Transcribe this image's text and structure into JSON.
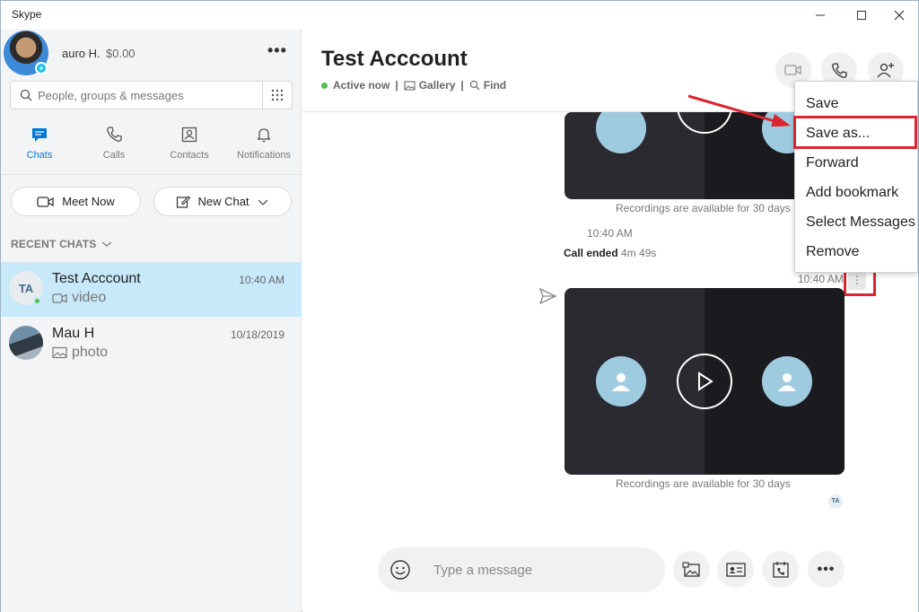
{
  "window": {
    "title": "Skype"
  },
  "profile": {
    "name": "auro H.",
    "credit": "$0.00"
  },
  "search": {
    "placeholder": "People, groups & messages"
  },
  "nav": [
    {
      "label": "Chats",
      "icon": "chat-icon",
      "active": true
    },
    {
      "label": "Calls",
      "icon": "phone-icon",
      "active": false
    },
    {
      "label": "Contacts",
      "icon": "contacts-icon",
      "active": false
    },
    {
      "label": "Notifications",
      "icon": "bell-icon",
      "active": false
    }
  ],
  "actions": {
    "meet_now": "Meet Now",
    "new_chat": "New Chat"
  },
  "recent": {
    "label": "RECENT CHATS"
  },
  "chats": [
    {
      "initials": "TA",
      "name": "Test Acccount",
      "sub": "video",
      "time": "10:40 AM",
      "active": true
    },
    {
      "name": "Mau H",
      "sub": "photo",
      "time": "10/18/2019",
      "active": false
    }
  ],
  "conversation": {
    "title": "Test Acccount",
    "status": "Active now",
    "gallery": "Gallery",
    "find": "Find"
  },
  "messages": {
    "recording_note_1": "Recordings are available for 30 days",
    "time_1": "10:40 AM",
    "call_ended": "Call ended",
    "call_duration": "4m 49s",
    "time_2": "10:40 AM",
    "recording_note_2": "Recordings are available for 30 days",
    "read_initials": "TA"
  },
  "context_menu": [
    "Save",
    "Save as...",
    "Forward",
    "Add bookmark",
    "Select Messages",
    "Remove"
  ],
  "composer": {
    "placeholder": "Type a message"
  },
  "colors": {
    "accent": "#0078d4",
    "highlight": "#d9262f",
    "online": "#4cc24c",
    "selected_chat": "#c7e9f9"
  }
}
